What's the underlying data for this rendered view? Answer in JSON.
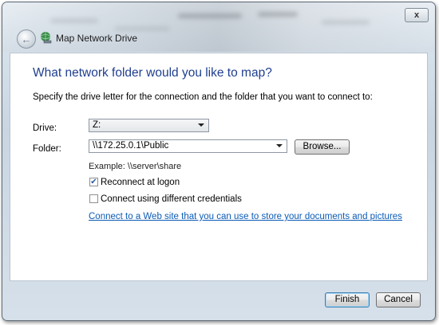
{
  "window": {
    "title": "Map Network Drive",
    "close_label": "x"
  },
  "icons": {
    "back": "back-arrow-icon",
    "network": "network-drive-icon",
    "close": "close-icon"
  },
  "main": {
    "heading": "What network folder would you like to map?",
    "instruction": "Specify the drive letter for the connection and the folder that you want to connect to:",
    "drive_label": "Drive:",
    "drive_value": "Z:",
    "folder_label": "Folder:",
    "folder_value": "\\\\172.25.0.1\\Public",
    "browse_label": "Browse...",
    "example": "Example: \\\\server\\share",
    "reconnect_label": "Reconnect at logon",
    "reconnect_checked": true,
    "credentials_label": "Connect using different credentials",
    "credentials_checked": false,
    "link_text": "Connect to a Web site that you can use to store your documents and pictures"
  },
  "footer": {
    "finish_label": "Finish",
    "cancel_label": "Cancel"
  },
  "colors": {
    "heading": "#1f3f8f",
    "link": "#0b5bb5"
  }
}
